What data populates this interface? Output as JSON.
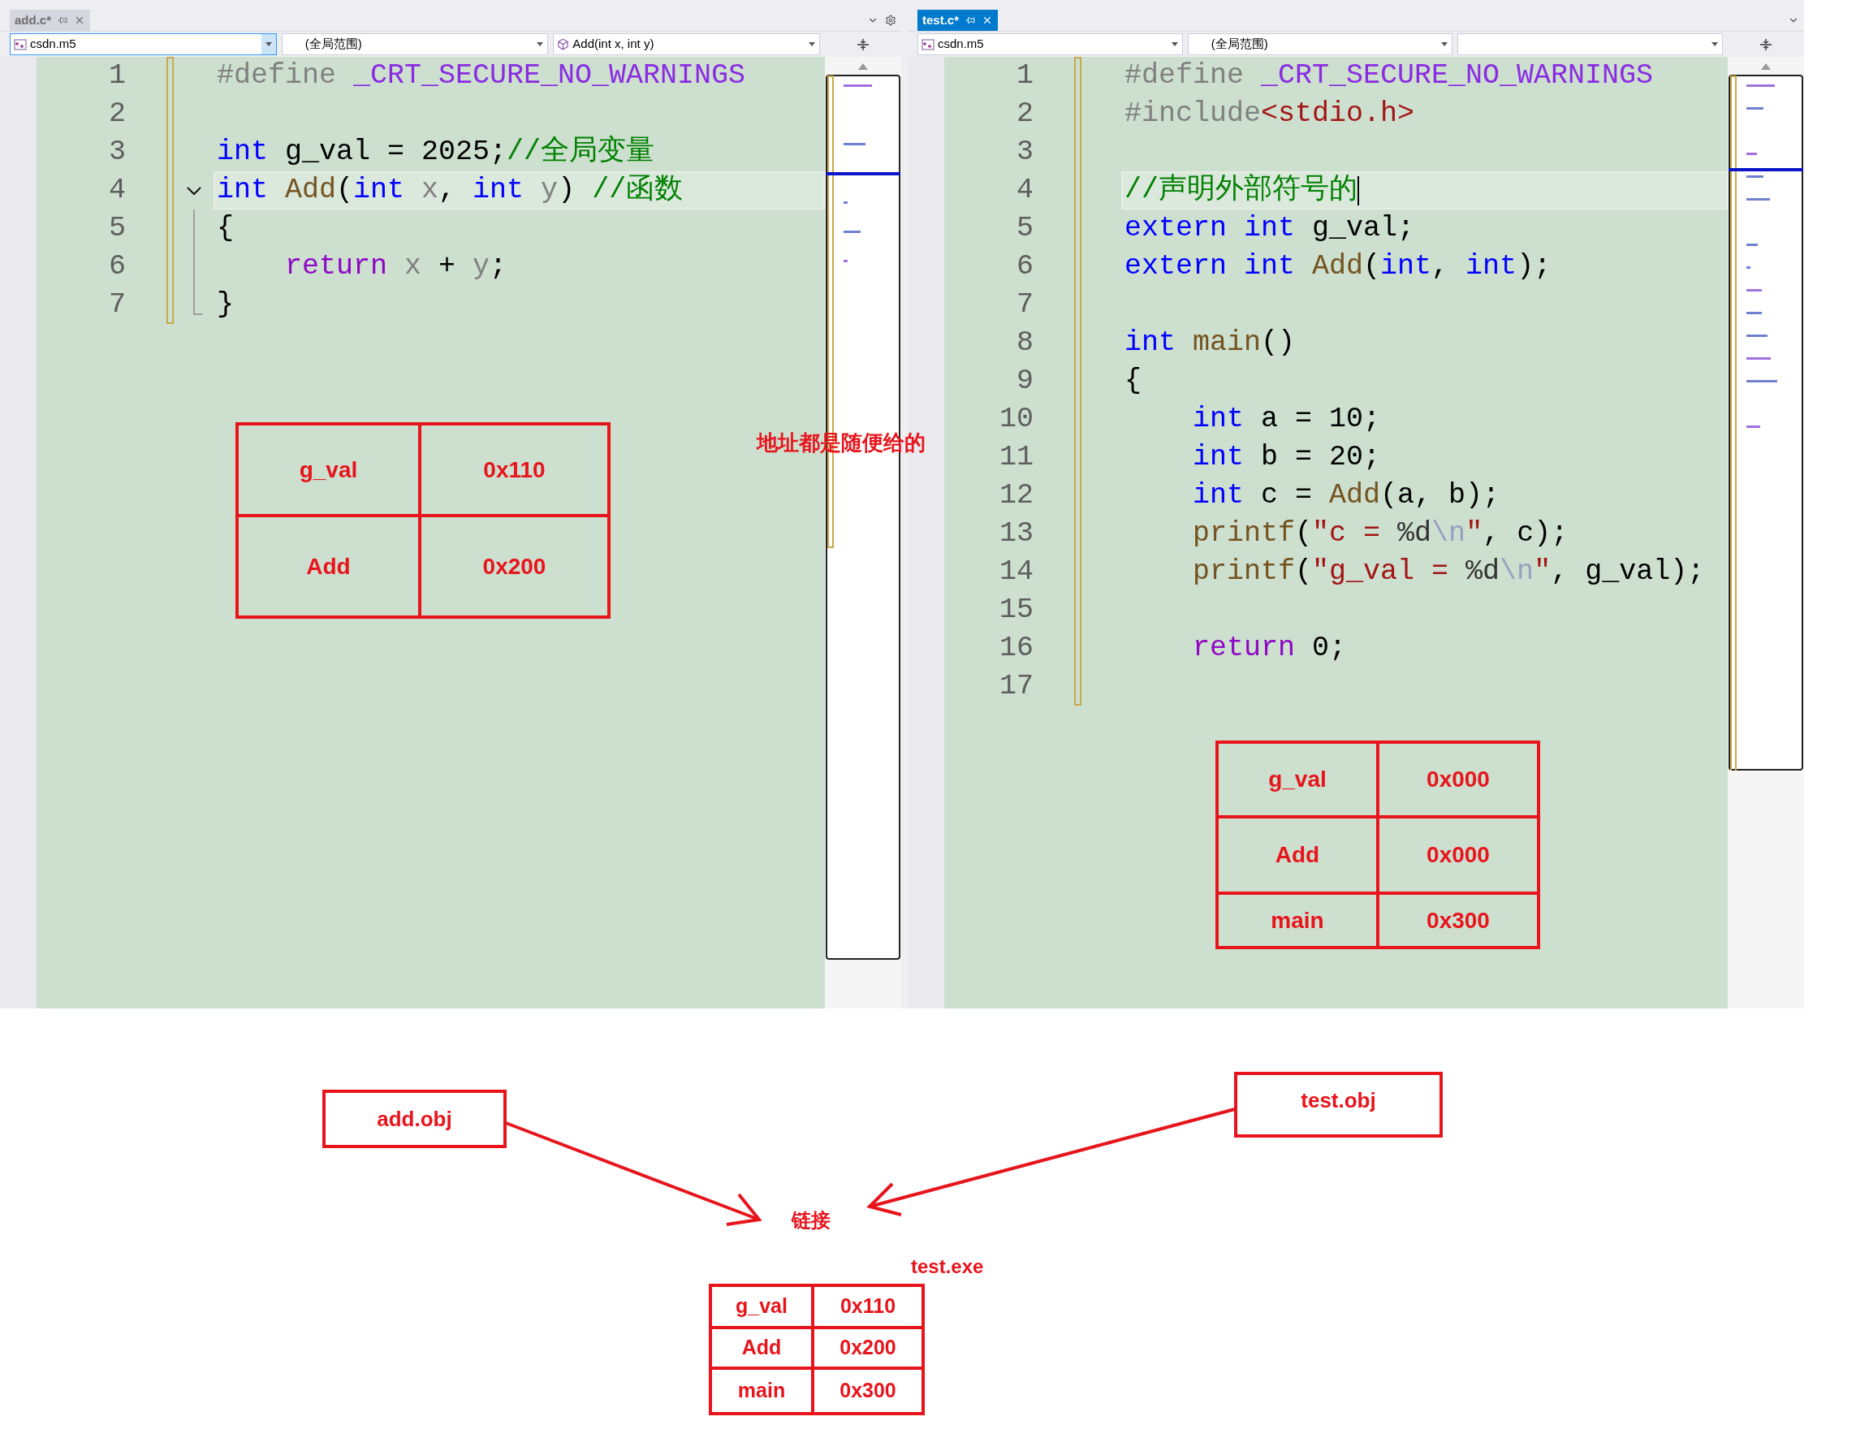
{
  "editors": [
    {
      "tab": {
        "title": "add.c*",
        "active": false
      },
      "dropdowns": [
        {
          "text": "csdn.m5",
          "focused": true
        },
        {
          "text": "(全局范围)",
          "focused": false
        },
        {
          "text": "Add(int x, int y)",
          "focused": false
        }
      ],
      "lines": [
        {
          "number": "1",
          "current": false,
          "fold": false,
          "tokens": [
            {
              "kind": "preprocessor",
              "text": "#define "
            },
            {
              "kind": "macro",
              "text": "_CRT_SECURE_NO_WARNINGS"
            }
          ]
        },
        {
          "number": "2",
          "current": false,
          "fold": false
        },
        {
          "number": "3",
          "current": false,
          "fold": false,
          "tokens": [
            {
              "kind": "keyword",
              "text": "int"
            },
            {
              "kind": "plain",
              "text": " g_val = 2025;"
            },
            {
              "kind": "comment",
              "text": "//全局变量"
            }
          ]
        },
        {
          "number": "4",
          "current": true,
          "fold": true,
          "tokens": [
            {
              "kind": "keyword",
              "text": "int "
            },
            {
              "kind": "function",
              "text": "Add"
            },
            {
              "kind": "plain",
              "text": "("
            },
            {
              "kind": "keyword",
              "text": "int "
            },
            {
              "kind": "param",
              "text": "x"
            },
            {
              "kind": "plain",
              "text": ", "
            },
            {
              "kind": "keyword",
              "text": "int "
            },
            {
              "kind": "param",
              "text": "y"
            },
            {
              "kind": "plain",
              "text": ") "
            },
            {
              "kind": "comment",
              "text": "//函数"
            }
          ]
        },
        {
          "number": "5",
          "current": false,
          "fold": false,
          "tokens": [
            {
              "kind": "plain",
              "text": "{"
            }
          ]
        },
        {
          "number": "6",
          "current": false,
          "fold": false,
          "tokens": [
            {
              "kind": "control",
              "text": "    return "
            },
            {
              "kind": "param",
              "text": "x"
            },
            {
              "kind": "plain",
              "text": " + "
            },
            {
              "kind": "param",
              "text": "y"
            },
            {
              "kind": "plain",
              "text": ";"
            }
          ]
        },
        {
          "number": "7",
          "current": false,
          "fold": false,
          "tokens": [
            {
              "kind": "plain",
              "text": "}"
            }
          ]
        }
      ]
    },
    {
      "tab": {
        "title": "test.c*",
        "active": true
      },
      "dropdowns": [
        {
          "text": "csdn.m5",
          "focused": false
        },
        {
          "text": "(全局范围)",
          "focused": false
        },
        {
          "focused": false
        }
      ],
      "lines": [
        {
          "number": "1",
          "current": false,
          "fold": false,
          "tokens": [
            {
              "kind": "preprocessor",
              "text": "#define "
            },
            {
              "kind": "macro",
              "text": "_CRT_SECURE_NO_WARNINGS"
            }
          ]
        },
        {
          "number": "2",
          "current": false,
          "fold": false,
          "tokens": [
            {
              "kind": "preprocessor",
              "text": "#include"
            },
            {
              "kind": "string",
              "text": "<stdio.h>"
            }
          ]
        },
        {
          "number": "3",
          "current": false,
          "fold": false
        },
        {
          "number": "4",
          "current": true,
          "fold": false,
          "tokens": [
            {
              "kind": "comment",
              "text": "//声明外部符号的"
            }
          ]
        },
        {
          "number": "5",
          "current": false,
          "fold": false,
          "tokens": [
            {
              "kind": "keyword",
              "text": "extern int"
            },
            {
              "kind": "plain",
              "text": " g_val;"
            }
          ]
        },
        {
          "number": "6",
          "current": false,
          "fold": false,
          "tokens": [
            {
              "kind": "keyword",
              "text": "extern int "
            },
            {
              "kind": "function",
              "text": "Add"
            },
            {
              "kind": "plain",
              "text": "("
            },
            {
              "kind": "keyword",
              "text": "int"
            },
            {
              "kind": "plain",
              "text": ", "
            },
            {
              "kind": "keyword",
              "text": "int"
            },
            {
              "kind": "plain",
              "text": ");"
            }
          ]
        },
        {
          "number": "7",
          "current": false,
          "fold": false
        },
        {
          "number": "8",
          "current": false,
          "fold": false,
          "tokens": [
            {
              "kind": "keyword",
              "text": "int "
            },
            {
              "kind": "function",
              "text": "main"
            },
            {
              "kind": "plain",
              "text": "()"
            }
          ]
        },
        {
          "number": "9",
          "current": false,
          "fold": false,
          "tokens": [
            {
              "kind": "plain",
              "text": "{"
            }
          ]
        },
        {
          "number": "10",
          "current": false,
          "fold": false,
          "tokens": [
            {
              "kind": "keyword",
              "text": "    int"
            },
            {
              "kind": "plain",
              "text": " a = 10;"
            }
          ]
        },
        {
          "number": "11",
          "current": false,
          "fold": false,
          "tokens": [
            {
              "kind": "keyword",
              "text": "    int"
            },
            {
              "kind": "plain",
              "text": " b = 20;"
            }
          ]
        },
        {
          "number": "12",
          "current": false,
          "fold": false,
          "tokens": [
            {
              "kind": "keyword",
              "text": "    int"
            },
            {
              "kind": "plain",
              "text": " c = "
            },
            {
              "kind": "function",
              "text": "Add"
            },
            {
              "kind": "plain",
              "text": "(a, b);"
            }
          ]
        },
        {
          "number": "13",
          "current": false,
          "fold": false,
          "tokens": [
            {
              "kind": "function",
              "text": "    printf"
            },
            {
              "kind": "plain",
              "text": "("
            },
            {
              "kind": "string",
              "text": "\"c = "
            },
            {
              "kind": "format",
              "text": "%d"
            },
            {
              "kind": "escape",
              "text": "\\n"
            },
            {
              "kind": "string",
              "text": "\""
            },
            {
              "kind": "plain",
              "text": ", c);"
            }
          ]
        },
        {
          "number": "14",
          "current": false,
          "fold": false,
          "tokens": [
            {
              "kind": "function",
              "text": "    printf"
            },
            {
              "kind": "plain",
              "text": "("
            },
            {
              "kind": "string",
              "text": "\"g_val = "
            },
            {
              "kind": "format",
              "text": "%d"
            },
            {
              "kind": "escape",
              "text": "\\n"
            },
            {
              "kind": "string",
              "text": "\""
            },
            {
              "kind": "plain",
              "text": ", g_val);"
            }
          ]
        },
        {
          "number": "15",
          "current": false,
          "fold": false
        },
        {
          "number": "16",
          "current": false,
          "fold": false,
          "tokens": [
            {
              "kind": "control",
              "text": "    return"
            },
            {
              "kind": "plain",
              "text": " 0;"
            }
          ]
        },
        {
          "number": "17",
          "current": false,
          "fold": false
        }
      ]
    }
  ],
  "annotations": {
    "note": "地址都是随便给的",
    "add_table": [
      {
        "symbol": "g_val",
        "address": "0x110"
      },
      {
        "symbol": "Add",
        "address": "0x200"
      }
    ],
    "test_table": [
      {
        "symbol": "g_val",
        "address": "0x000"
      },
      {
        "symbol": "Add",
        "address": "0x000"
      },
      {
        "symbol": "main",
        "address": "0x300"
      }
    ],
    "add_obj": "add.obj",
    "test_obj": "test.obj",
    "link_label": "链接",
    "exe_label": "test.exe",
    "exe_table": [
      {
        "symbol": "g_val",
        "address": "0x110"
      },
      {
        "symbol": "Add",
        "address": "0x200"
      },
      {
        "symbol": "main",
        "address": "0x300"
      }
    ]
  }
}
